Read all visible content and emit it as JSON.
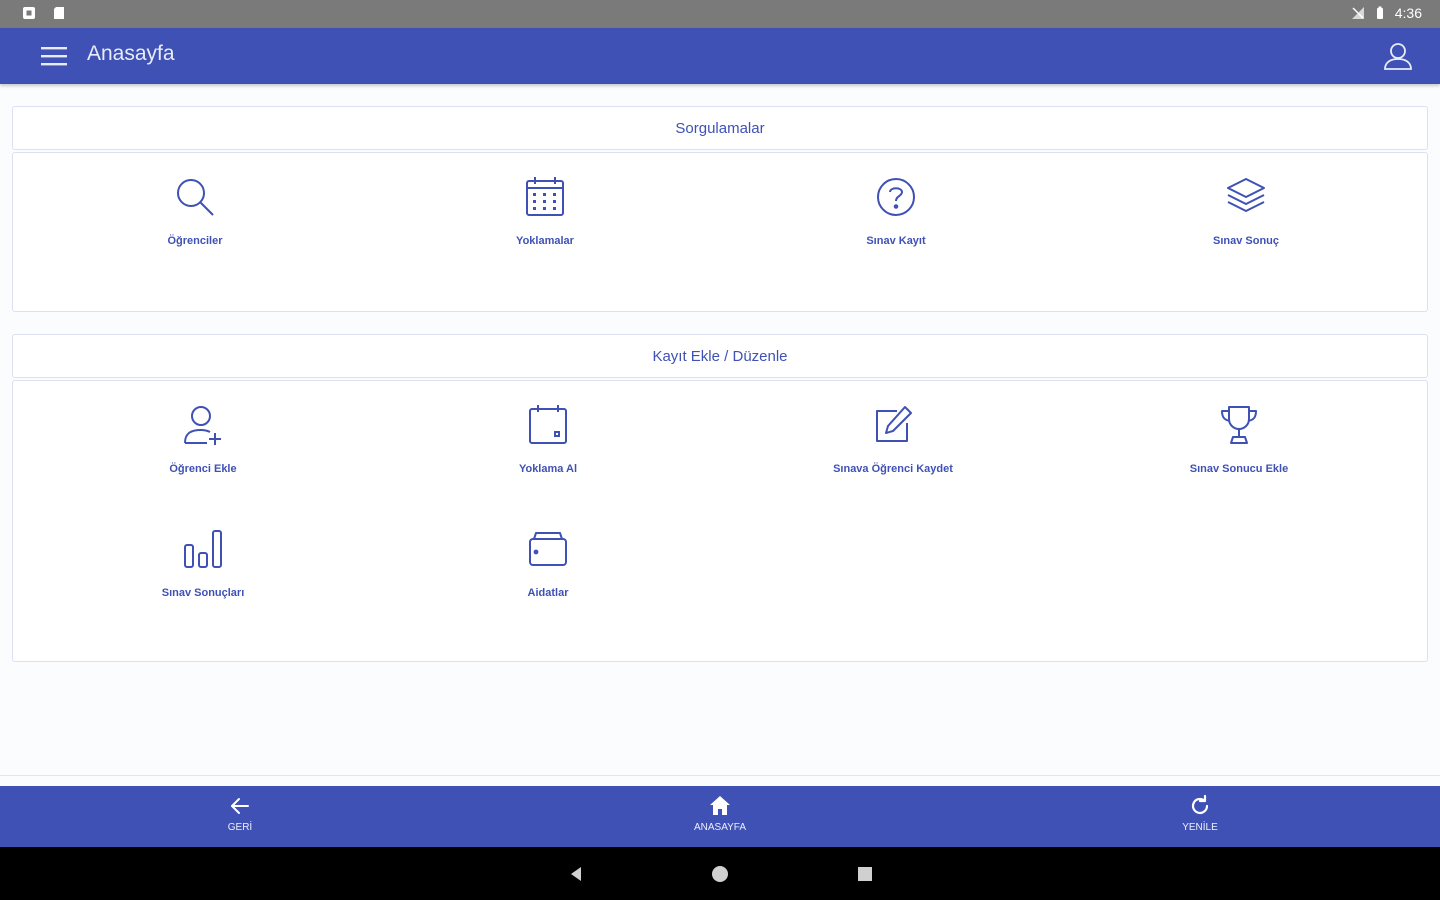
{
  "status_bar": {
    "time": "4:36"
  },
  "app_bar": {
    "title": "Anasayfa",
    "menu_icon": "hamburger-menu-icon",
    "profile_icon": "user-profile-icon"
  },
  "sections": [
    {
      "title": "Sorgulamalar",
      "items": [
        {
          "label": "Öğrenciler",
          "icon": "search-icon"
        },
        {
          "label": "Yoklamalar",
          "icon": "calendar-grid-icon"
        },
        {
          "label": "Sınav Kayıt",
          "icon": "question-circle-icon"
        },
        {
          "label": "Sınav Sonuç",
          "icon": "layers-icon"
        }
      ]
    },
    {
      "title": "Kayıt Ekle / Düzenle",
      "items": [
        {
          "label": "Öğrenci Ekle",
          "icon": "add-user-icon"
        },
        {
          "label": "Yoklama Al",
          "icon": "calendar-icon"
        },
        {
          "label": "Sınava Öğrenci Kaydet",
          "icon": "edit-icon"
        },
        {
          "label": "Sınav Sonucu Ekle",
          "icon": "trophy-icon"
        },
        {
          "label": "Sınav Sonuçları",
          "icon": "bar-chart-icon"
        },
        {
          "label": "Aidatlar",
          "icon": "wallet-icon"
        }
      ]
    }
  ],
  "bottom_nav": [
    {
      "label": "GERİ",
      "icon": "arrow-left-icon"
    },
    {
      "label": "ANASAYFA",
      "icon": "home-icon"
    },
    {
      "label": "YENİLE",
      "icon": "refresh-icon"
    }
  ],
  "colors": {
    "primary": "#3f51b5",
    "status_bar": "#7a7a7a",
    "system_nav": "#000000"
  }
}
